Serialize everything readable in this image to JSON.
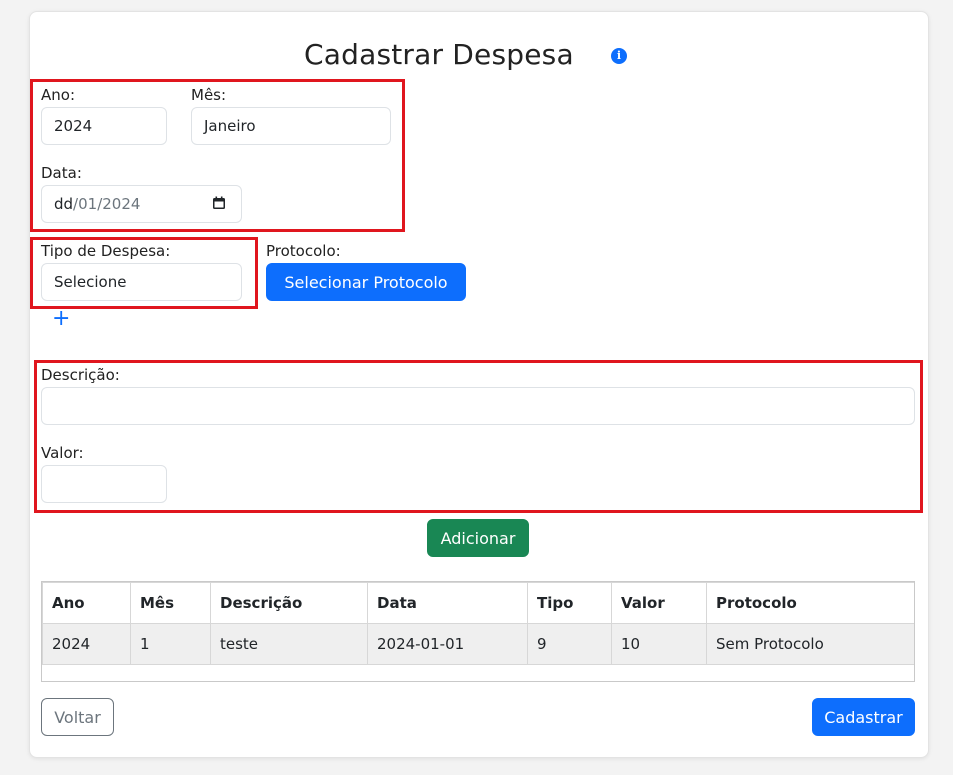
{
  "form": {
    "title": "Cadastrar Despesa",
    "info_icon": "i",
    "ano_label": "Ano:",
    "ano_value": "2024",
    "mes_label": "Mês:",
    "mes_value": "Janeiro",
    "data_label": "Data:",
    "data_value_dd": "dd",
    "data_value_rest": "/01/2024",
    "tipo_label": "Tipo de Despesa:",
    "tipo_value": "Selecione",
    "protocolo_label": "Protocolo:",
    "protocolo_button": "Selecionar Protocolo",
    "add_tipo": "+",
    "descricao_label": "Descrição:",
    "descricao_value": "",
    "valor_label": "Valor:",
    "valor_value": "",
    "adicionar_button": "Adicionar",
    "voltar_button": "Voltar",
    "cadastrar_button": "Cadastrar"
  },
  "table": {
    "headers": [
      "Ano",
      "Mês",
      "Descrição",
      "Data",
      "Tipo",
      "Valor",
      "Protocolo"
    ],
    "rows": [
      [
        "2024",
        "1",
        "teste",
        "2024-01-01",
        "9",
        "10",
        "Sem Protocolo"
      ]
    ]
  },
  "colors": {
    "primary": "#0d6efd",
    "success": "#198754",
    "highlight": "#e0161e"
  },
  "icons": {
    "info": "info-icon",
    "calendar": "calendar-icon",
    "plus": "plus-icon"
  }
}
